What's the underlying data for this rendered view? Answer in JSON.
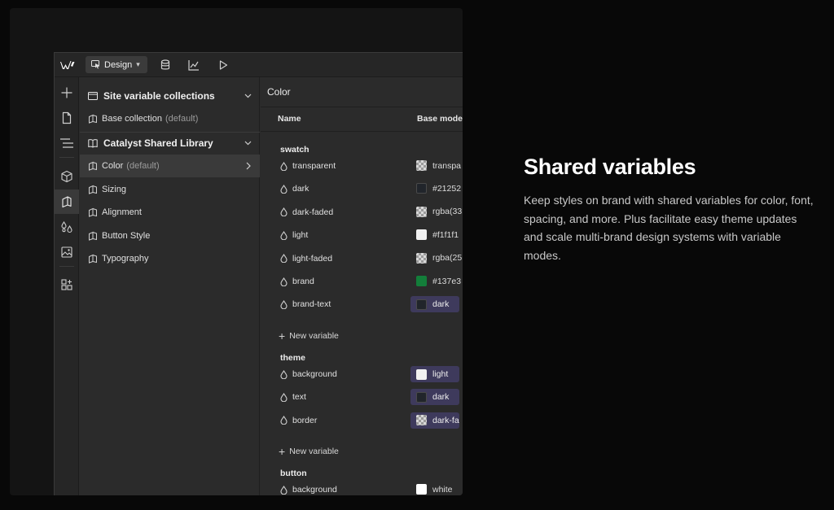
{
  "toolbar": {
    "mode_label": "Design",
    "icons": [
      "webflow-logo-icon",
      "cursor-icon",
      "chevron-down-icon",
      "database-icon",
      "chart-icon",
      "play-icon"
    ]
  },
  "rail": {
    "icons": [
      "plus-icon",
      "page-icon",
      "navigator-icon",
      "box-icon",
      "variables-icon",
      "drops-icon",
      "image-icon",
      "apps-icon"
    ]
  },
  "sidebar": {
    "site_section_title": "Site variable collections",
    "base_collection": {
      "label": "Base collection",
      "suffix": "(default)"
    },
    "library_section_title": "Catalyst Shared Library",
    "items": [
      {
        "label": "Color",
        "suffix": "(default)"
      },
      {
        "label": "Sizing",
        "suffix": ""
      },
      {
        "label": "Alignment",
        "suffix": ""
      },
      {
        "label": "Button Style",
        "suffix": ""
      },
      {
        "label": "Typography",
        "suffix": ""
      }
    ]
  },
  "main": {
    "title": "Color",
    "col_name": "Name",
    "col_base": "Base mode",
    "groups": {
      "swatch": "swatch",
      "theme": "theme",
      "button": "button"
    },
    "swatch_vars": [
      {
        "name": "transparent",
        "value": "transpa",
        "swatch": "checker"
      },
      {
        "name": "dark",
        "value": "#21252",
        "swatch": "#21252b"
      },
      {
        "name": "dark-faded",
        "value": "rgba(33",
        "swatch": "checker"
      },
      {
        "name": "light",
        "value": "#f1f1f1",
        "swatch": "#f1f1f1"
      },
      {
        "name": "light-faded",
        "value": "rgba(25",
        "swatch": "checker"
      },
      {
        "name": "brand",
        "value": "#137e3",
        "swatch": "#137e3a"
      },
      {
        "name": "brand-text",
        "value": "dark",
        "swatch": "#21252b",
        "alias": true
      }
    ],
    "theme_vars": [
      {
        "name": "background",
        "value": "light",
        "swatch": "#f1f1f1",
        "alias": true
      },
      {
        "name": "text",
        "value": "dark",
        "swatch": "#21252b",
        "alias": true
      },
      {
        "name": "border",
        "value": "dark-fa",
        "swatch": "checker",
        "alias": true
      }
    ],
    "button_vars": [
      {
        "name": "background",
        "value": "white",
        "swatch": "#ffffff"
      }
    ],
    "new_variable_label": "New variable"
  },
  "copy": {
    "heading": "Shared variables",
    "body": "Keep styles on brand with shared variables for color, font, spacing, and more. Plus facilitate easy theme updates and scale multi-brand design systems with variable modes."
  },
  "colors": {
    "alias_pill": "#3e3a5c",
    "selected_row": "#3a3a3a",
    "brand": "#137e3a"
  }
}
